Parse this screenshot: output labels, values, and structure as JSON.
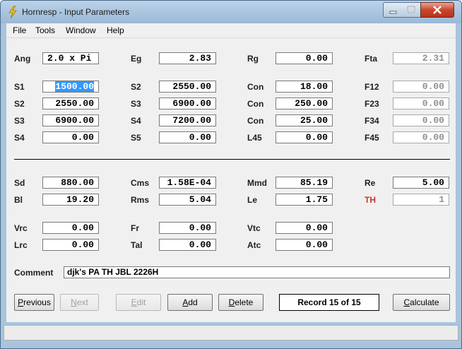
{
  "window": {
    "title": "Hornresp - Input Parameters"
  },
  "menu": [
    "File",
    "Tools",
    "Window",
    "Help"
  ],
  "horn": {
    "row1": [
      {
        "label": "Ang",
        "value": "2.0 x Pi"
      },
      {
        "label": "Eg",
        "value": "2.83"
      },
      {
        "label": "Rg",
        "value": "0.00"
      },
      {
        "label": "Fta",
        "value": "2.31"
      }
    ],
    "row2": [
      {
        "label": "S1",
        "value": "1500.00"
      },
      {
        "label": "S2",
        "value": "2550.00"
      },
      {
        "label": "Con",
        "value": "18.00"
      },
      {
        "label": "F12",
        "value": "0.00"
      }
    ],
    "row3": [
      {
        "label": "S2",
        "value": "2550.00"
      },
      {
        "label": "S3",
        "value": "6900.00"
      },
      {
        "label": "Con",
        "value": "250.00"
      },
      {
        "label": "F23",
        "value": "0.00"
      }
    ],
    "row4": [
      {
        "label": "S3",
        "value": "6900.00"
      },
      {
        "label": "S4",
        "value": "7200.00"
      },
      {
        "label": "Con",
        "value": "25.00"
      },
      {
        "label": "F34",
        "value": "0.00"
      }
    ],
    "row5": [
      {
        "label": "S4",
        "value": "0.00"
      },
      {
        "label": "S5",
        "value": "0.00"
      },
      {
        "label": "L45",
        "value": "0.00"
      },
      {
        "label": "F45",
        "value": "0.00"
      }
    ]
  },
  "driver": {
    "row1": [
      {
        "label": "Sd",
        "value": "880.00"
      },
      {
        "label": "Cms",
        "value": "1.58E-04"
      },
      {
        "label": "Mmd",
        "value": "85.19"
      },
      {
        "label": "Re",
        "value": "5.00"
      }
    ],
    "row2": [
      {
        "label": "Bl",
        "value": "19.20"
      },
      {
        "label": "Rms",
        "value": "5.04"
      },
      {
        "label": "Le",
        "value": "1.75"
      },
      {
        "label": "TH",
        "value": "1"
      }
    ]
  },
  "chamber": {
    "row1": [
      {
        "label": "Vrc",
        "value": "0.00"
      },
      {
        "label": "Fr",
        "value": "0.00"
      },
      {
        "label": "Vtc",
        "value": "0.00"
      }
    ],
    "row2": [
      {
        "label": "Lrc",
        "value": "0.00"
      },
      {
        "label": "Tal",
        "value": "0.00"
      },
      {
        "label": "Atc",
        "value": "0.00"
      }
    ]
  },
  "comment": {
    "label": "Comment",
    "value": "djk's PA TH JBL 2226H"
  },
  "buttons": {
    "previous": {
      "first": "P",
      "rest": "revious"
    },
    "next": {
      "first": "N",
      "rest": "ext"
    },
    "edit": {
      "first": "E",
      "rest": "dit"
    },
    "add": {
      "first": "A",
      "rest": "dd"
    },
    "delete": {
      "first": "D",
      "rest": "elete"
    },
    "calculate": {
      "first": "C",
      "rest": "alculate"
    }
  },
  "record": "Record 15 of 15",
  "colors": {
    "accent_red": "#c0392b",
    "selection": "#3399ff"
  }
}
